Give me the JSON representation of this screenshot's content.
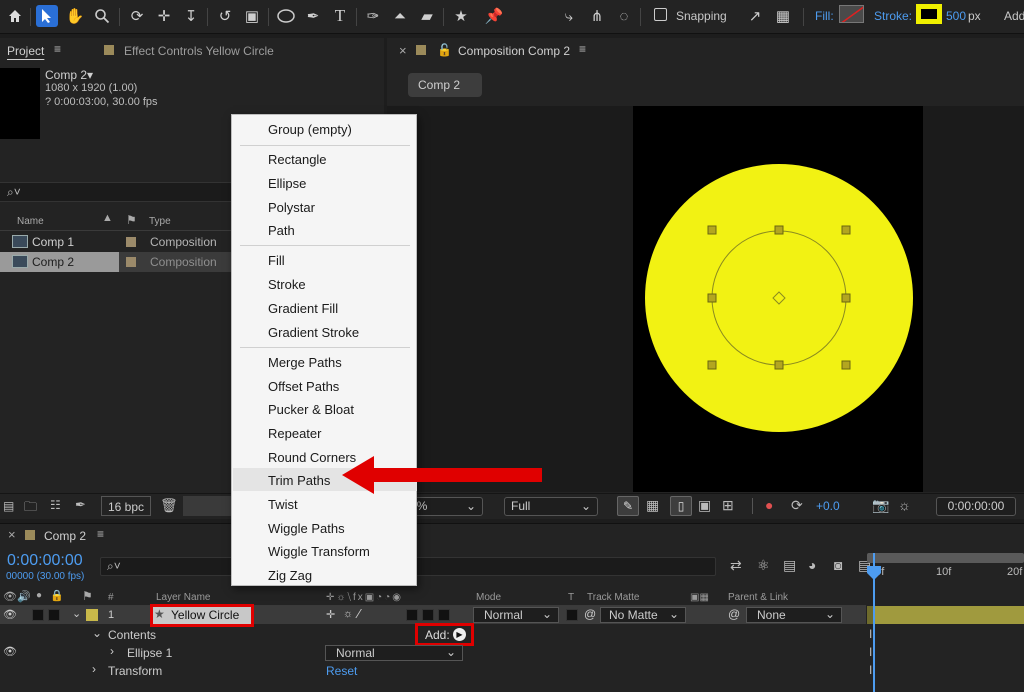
{
  "toolbar": {
    "snapping_label": "Snapping",
    "fill_label": "Fill:",
    "stroke_label": "Stroke:",
    "stroke_width": "500",
    "stroke_unit": "px",
    "add_label": "Add:",
    "accent": "#2a6fd6"
  },
  "project_panel": {
    "tab_label": "Project",
    "effect_tab_label": "Effect Controls Yellow Circle",
    "comp_name": "Comp 2▾",
    "comp_dims": "1080 x 1920 (1.00)",
    "comp_duration": "? 0:00:03:00, 30.00 fps",
    "search_icon_text": "⌕˅",
    "col_name": "Name",
    "col_type": "Type",
    "items": [
      {
        "name": "Comp 1",
        "type": "Composition"
      },
      {
        "name": "Comp 2",
        "type": "Composition"
      }
    ]
  },
  "comp_panel": {
    "tab_label": "Composition Comp 2",
    "sub_tab": "Comp 2",
    "circle_color": "#f2f213"
  },
  "viewer_bar": {
    "bpc": "16 bpc",
    "zoom": "0%",
    "resolution": "Full",
    "exposure": "+0.0",
    "timecode": "0:00:00:00"
  },
  "timeline": {
    "tab_label": "Comp 2",
    "timecode": "0:00:00:00",
    "frames": "00000 (30.00 fps)",
    "search_icon_text": "⌕˅",
    "col_num": "#",
    "col_layer_name": "Layer Name",
    "col_mode": "Mode",
    "col_t": "T",
    "col_track_matte": "Track Matte",
    "col_parent": "Parent & Link",
    "ruler": [
      "00f",
      "10f",
      "20f"
    ],
    "layer": {
      "num": "1",
      "name": "Yellow Circle",
      "mode": "Normal",
      "matte": "No Matte",
      "parent": "None"
    },
    "contents_label": "Contents",
    "add_label": "Add:",
    "ellipse_label": "Ellipse 1",
    "ellipse_mode": "Normal",
    "transform_label": "Transform",
    "reset_label": "Reset"
  },
  "menu": {
    "items": [
      "Group (empty)",
      "Rectangle",
      "Ellipse",
      "Polystar",
      "Path",
      "Fill",
      "Stroke",
      "Gradient Fill",
      "Gradient Stroke",
      "Merge Paths",
      "Offset Paths",
      "Pucker & Bloat",
      "Repeater",
      "Round Corners",
      "Trim Paths",
      "Twist",
      "Wiggle Paths",
      "Wiggle Transform",
      "Zig Zag"
    ],
    "highlighted": "Trim Paths"
  }
}
